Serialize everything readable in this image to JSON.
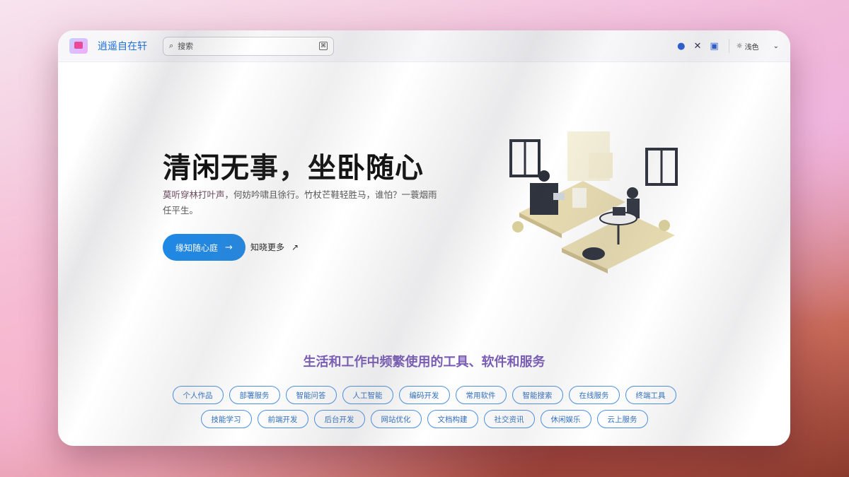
{
  "header": {
    "site_name": "逍遥自在轩",
    "search_placeholder": "搜索",
    "search_shortcut": "⌘",
    "social_icons": [
      "github-icon",
      "x-icon",
      "mastodon-icon"
    ],
    "theme_label": "浅色"
  },
  "hero": {
    "title": "清闲无事，坐卧随心",
    "desc_highlight": "莫听穿林打叶声，",
    "desc_rest": "何妨吟啸且徐行。竹杖芒鞋轻胜马，谁怕？一蓑烟雨任平生。",
    "primary_button": "缘知随心庭",
    "secondary_link": "知晓更多"
  },
  "services": {
    "title": "生活和工作中频繁使用的工具、软件和服务",
    "row1": [
      "个人作品",
      "部署服务",
      "智能问答",
      "人工智能",
      "编码开发",
      "常用软件",
      "智能搜索",
      "在线服务",
      "终端工具"
    ],
    "row2": [
      "技能学习",
      "前端开发",
      "后台开发",
      "网站优化",
      "文档构建",
      "社交资讯",
      "休闲娱乐",
      "云上服务"
    ]
  },
  "colors": {
    "accent": "#1e88e5",
    "title_gradient": "#7a5bb8"
  }
}
